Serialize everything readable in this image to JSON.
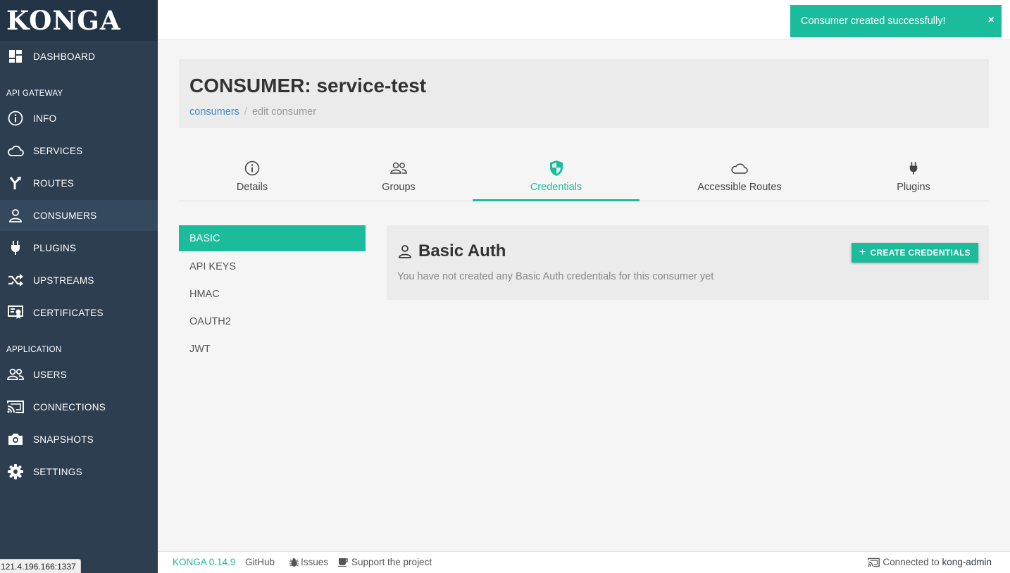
{
  "app": {
    "logo": "KONGA"
  },
  "sidebar": {
    "dashboard": "DASHBOARD",
    "section_gateway": "API GATEWAY",
    "section_application": "APPLICATION",
    "items": [
      {
        "label": "INFO",
        "icon": "info-icon"
      },
      {
        "label": "SERVICES",
        "icon": "cloud-icon"
      },
      {
        "label": "ROUTES",
        "icon": "fork-icon"
      },
      {
        "label": "CONSUMERS",
        "icon": "person-icon"
      },
      {
        "label": "PLUGINS",
        "icon": "plug-icon"
      },
      {
        "label": "UPSTREAMS",
        "icon": "shuffle-icon"
      },
      {
        "label": "CERTIFICATES",
        "icon": "certificate-icon"
      }
    ],
    "app_items": [
      {
        "label": "USERS",
        "icon": "users-icon"
      },
      {
        "label": "CONNECTIONS",
        "icon": "cast-icon"
      },
      {
        "label": "SNAPSHOTS",
        "icon": "camera-icon"
      },
      {
        "label": "SETTINGS",
        "icon": "gear-icon"
      }
    ]
  },
  "toast": {
    "message": "Consumer created successfully!",
    "close": "×"
  },
  "header": {
    "title": "CONSUMER: service-test",
    "breadcrumb": {
      "link": "consumers",
      "separator": "/",
      "current": "edit consumer"
    }
  },
  "tabs": [
    {
      "label": "Details",
      "icon": "info-icon"
    },
    {
      "label": "Groups",
      "icon": "users-icon"
    },
    {
      "label": "Credentials",
      "icon": "shield-icon"
    },
    {
      "label": "Accessible Routes",
      "icon": "cloud-icon"
    },
    {
      "label": "Plugins",
      "icon": "plug-icon"
    }
  ],
  "active_tab": "Credentials",
  "credentials": {
    "types": [
      "BASIC",
      "API KEYS",
      "HMAC",
      "OAUTH2",
      "JWT"
    ],
    "selected": "BASIC",
    "panel": {
      "title": "Basic Auth",
      "message": "You have not created any Basic Auth credentials for this consumer yet",
      "button": "CREATE CREDENTIALS"
    }
  },
  "footer": {
    "version": "KONGA 0.14.9",
    "github": "GitHub",
    "issues": "Issues",
    "support": "Support the project",
    "connected_prefix": "Connected to",
    "connection": "kong-admin"
  },
  "status_url": "121.4.196.166:1337",
  "colors": {
    "sidebar": "#2c3e50",
    "accent": "#1abc9c",
    "link": "#3a8fd0"
  }
}
